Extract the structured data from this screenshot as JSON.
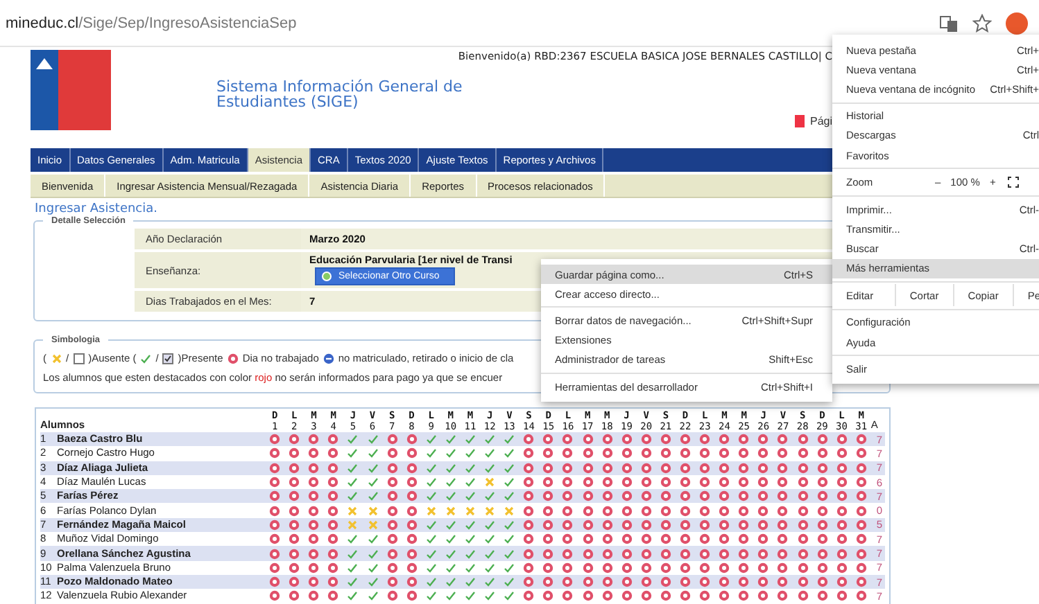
{
  "browser": {
    "url_host": "mineduc.cl",
    "url_path": "/Sige/Sep/IngresoAsistenciaSep"
  },
  "header": {
    "welcome": "Bienvenido(a) RBD:2367  ESCUELA BASICA JOSE BERNALES CASTILLO| C",
    "title_line1": "Sistema Información General de",
    "title_line2": "Estudiantes (SIGE)",
    "print_link": "Pági"
  },
  "tabs": [
    {
      "label": "Inicio",
      "selected": false
    },
    {
      "label": "Datos Generales",
      "selected": false
    },
    {
      "label": "Adm. Matricula",
      "selected": false
    },
    {
      "label": "Asistencia",
      "selected": true
    },
    {
      "label": "CRA",
      "selected": false
    },
    {
      "label": "Textos 2020",
      "selected": false
    },
    {
      "label": "Ajuste Textos",
      "selected": false
    },
    {
      "label": "Reportes y Archivos",
      "selected": false
    }
  ],
  "subtabs": [
    "Bienvenida",
    "Ingresar Asistencia Mensual/Rezagada",
    "Asistencia Diaria",
    "Reportes",
    "Procesos relacionados"
  ],
  "section_title": "Ingresar Asistencia.",
  "detail": {
    "legend": "Detalle Selección",
    "rows": [
      {
        "label": "Año Declaración",
        "value": "Marzo 2020"
      },
      {
        "label": "Enseñanza:",
        "value": "Educación Parvularia [1er nivel de Transi",
        "button": "Seleccionar Otro Curso"
      },
      {
        "label": "Dias Trabajados en el Mes:",
        "value": "7"
      }
    ]
  },
  "legend_box": {
    "legend": "Simbologia",
    "open_paren": "(",
    "slash_1": "/",
    "absent": ")Ausente (",
    "slash_2": "/",
    "present": ")Presente",
    "not_worked": "Dia no trabajado",
    "not_enrolled": "no matriculado, retirado o inicio de cla",
    "note_before": "Los alumnos que esten destacados con color",
    "note_highlight": "rojo",
    "note_after": "no serán informados para pago ya que se encuer"
  },
  "grid": {
    "header": "Alumnos",
    "total_header": "A",
    "days": [
      {
        "letter": "D",
        "number": "1"
      },
      {
        "letter": "L",
        "number": "2"
      },
      {
        "letter": "M",
        "number": "3"
      },
      {
        "letter": "M",
        "number": "4"
      },
      {
        "letter": "J",
        "number": "5"
      },
      {
        "letter": "V",
        "number": "6"
      },
      {
        "letter": "S",
        "number": "7"
      },
      {
        "letter": "D",
        "number": "8"
      },
      {
        "letter": "L",
        "number": "9"
      },
      {
        "letter": "M",
        "number": "10"
      },
      {
        "letter": "M",
        "number": "11"
      },
      {
        "letter": "J",
        "number": "12"
      },
      {
        "letter": "V",
        "number": "13"
      },
      {
        "letter": "S",
        "number": "14"
      },
      {
        "letter": "D",
        "number": "15"
      },
      {
        "letter": "L",
        "number": "16"
      },
      {
        "letter": "M",
        "number": "17"
      },
      {
        "letter": "M",
        "number": "18"
      },
      {
        "letter": "J",
        "number": "19"
      },
      {
        "letter": "V",
        "number": "20"
      },
      {
        "letter": "S",
        "number": "21"
      },
      {
        "letter": "D",
        "number": "22"
      },
      {
        "letter": "L",
        "number": "23"
      },
      {
        "letter": "M",
        "number": "24"
      },
      {
        "letter": "M",
        "number": "25"
      },
      {
        "letter": "J",
        "number": "26"
      },
      {
        "letter": "V",
        "number": "27"
      },
      {
        "letter": "S",
        "number": "28"
      },
      {
        "letter": "D",
        "number": "29"
      },
      {
        "letter": "L",
        "number": "30"
      },
      {
        "letter": "M",
        "number": "31"
      }
    ],
    "rows": [
      {
        "number": "1",
        "name": "Baeza Castro Blu",
        "total": "7",
        "marks": [
          {
            "kind": "o"
          },
          {
            "kind": "o"
          },
          {
            "kind": "o"
          },
          {
            "kind": "o"
          },
          {
            "kind": "p"
          },
          {
            "kind": "p"
          },
          {
            "kind": "o"
          },
          {
            "kind": "o"
          },
          {
            "kind": "p"
          },
          {
            "kind": "p"
          },
          {
            "kind": "p"
          },
          {
            "kind": "p"
          },
          {
            "kind": "p"
          },
          {
            "kind": "o"
          },
          {
            "kind": "o"
          },
          {
            "kind": "o"
          },
          {
            "kind": "o"
          },
          {
            "kind": "o"
          },
          {
            "kind": "o"
          },
          {
            "kind": "o"
          },
          {
            "kind": "o"
          },
          {
            "kind": "o"
          },
          {
            "kind": "o"
          },
          {
            "kind": "o"
          },
          {
            "kind": "o"
          },
          {
            "kind": "o"
          },
          {
            "kind": "o"
          },
          {
            "kind": "o"
          },
          {
            "kind": "o"
          },
          {
            "kind": "o"
          },
          {
            "kind": "o"
          }
        ]
      },
      {
        "number": "2",
        "name": "Cornejo Castro Hugo",
        "total": "7",
        "marks": [
          {
            "kind": "o"
          },
          {
            "kind": "o"
          },
          {
            "kind": "o"
          },
          {
            "kind": "o"
          },
          {
            "kind": "p"
          },
          {
            "kind": "p"
          },
          {
            "kind": "o"
          },
          {
            "kind": "o"
          },
          {
            "kind": "p"
          },
          {
            "kind": "p"
          },
          {
            "kind": "p"
          },
          {
            "kind": "p"
          },
          {
            "kind": "p"
          },
          {
            "kind": "o"
          },
          {
            "kind": "o"
          },
          {
            "kind": "o"
          },
          {
            "kind": "o"
          },
          {
            "kind": "o"
          },
          {
            "kind": "o"
          },
          {
            "kind": "o"
          },
          {
            "kind": "o"
          },
          {
            "kind": "o"
          },
          {
            "kind": "o"
          },
          {
            "kind": "o"
          },
          {
            "kind": "o"
          },
          {
            "kind": "o"
          },
          {
            "kind": "o"
          },
          {
            "kind": "o"
          },
          {
            "kind": "o"
          },
          {
            "kind": "o"
          },
          {
            "kind": "o"
          }
        ]
      },
      {
        "number": "3",
        "name": "Díaz Aliaga Julieta",
        "total": "7",
        "marks": [
          {
            "kind": "o"
          },
          {
            "kind": "o"
          },
          {
            "kind": "o"
          },
          {
            "kind": "o"
          },
          {
            "kind": "p"
          },
          {
            "kind": "p"
          },
          {
            "kind": "o"
          },
          {
            "kind": "o"
          },
          {
            "kind": "p"
          },
          {
            "kind": "p"
          },
          {
            "kind": "p"
          },
          {
            "kind": "p"
          },
          {
            "kind": "p"
          },
          {
            "kind": "o"
          },
          {
            "kind": "o"
          },
          {
            "kind": "o"
          },
          {
            "kind": "o"
          },
          {
            "kind": "o"
          },
          {
            "kind": "o"
          },
          {
            "kind": "o"
          },
          {
            "kind": "o"
          },
          {
            "kind": "o"
          },
          {
            "kind": "o"
          },
          {
            "kind": "o"
          },
          {
            "kind": "o"
          },
          {
            "kind": "o"
          },
          {
            "kind": "o"
          },
          {
            "kind": "o"
          },
          {
            "kind": "o"
          },
          {
            "kind": "o"
          },
          {
            "kind": "o"
          }
        ]
      },
      {
        "number": "4",
        "name": "Díaz Maulén Lucas",
        "total": "6",
        "marks": [
          {
            "kind": "o"
          },
          {
            "kind": "o"
          },
          {
            "kind": "o"
          },
          {
            "kind": "o"
          },
          {
            "kind": "p"
          },
          {
            "kind": "p"
          },
          {
            "kind": "o"
          },
          {
            "kind": "o"
          },
          {
            "kind": "p"
          },
          {
            "kind": "p"
          },
          {
            "kind": "p"
          },
          {
            "kind": "a"
          },
          {
            "kind": "p"
          },
          {
            "kind": "o"
          },
          {
            "kind": "o"
          },
          {
            "kind": "o"
          },
          {
            "kind": "o"
          },
          {
            "kind": "o"
          },
          {
            "kind": "o"
          },
          {
            "kind": "o"
          },
          {
            "kind": "o"
          },
          {
            "kind": "o"
          },
          {
            "kind": "o"
          },
          {
            "kind": "o"
          },
          {
            "kind": "o"
          },
          {
            "kind": "o"
          },
          {
            "kind": "o"
          },
          {
            "kind": "o"
          },
          {
            "kind": "o"
          },
          {
            "kind": "o"
          },
          {
            "kind": "o"
          }
        ]
      },
      {
        "number": "5",
        "name": "Farías Pérez",
        "total": "7",
        "marks": [
          {
            "kind": "o"
          },
          {
            "kind": "o"
          },
          {
            "kind": "o"
          },
          {
            "kind": "o"
          },
          {
            "kind": "p"
          },
          {
            "kind": "p"
          },
          {
            "kind": "o"
          },
          {
            "kind": "o"
          },
          {
            "kind": "p"
          },
          {
            "kind": "p"
          },
          {
            "kind": "p"
          },
          {
            "kind": "p"
          },
          {
            "kind": "p"
          },
          {
            "kind": "o"
          },
          {
            "kind": "o"
          },
          {
            "kind": "o"
          },
          {
            "kind": "o"
          },
          {
            "kind": "o"
          },
          {
            "kind": "o"
          },
          {
            "kind": "o"
          },
          {
            "kind": "o"
          },
          {
            "kind": "o"
          },
          {
            "kind": "o"
          },
          {
            "kind": "o"
          },
          {
            "kind": "o"
          },
          {
            "kind": "o"
          },
          {
            "kind": "o"
          },
          {
            "kind": "o"
          },
          {
            "kind": "o"
          },
          {
            "kind": "o"
          },
          {
            "kind": "o"
          }
        ]
      },
      {
        "number": "6",
        "name": "Farías Polanco Dylan",
        "total": "0",
        "marks": [
          {
            "kind": "o"
          },
          {
            "kind": "o"
          },
          {
            "kind": "o"
          },
          {
            "kind": "o"
          },
          {
            "kind": "a"
          },
          {
            "kind": "a"
          },
          {
            "kind": "o"
          },
          {
            "kind": "o"
          },
          {
            "kind": "a"
          },
          {
            "kind": "a"
          },
          {
            "kind": "a"
          },
          {
            "kind": "a"
          },
          {
            "kind": "a"
          },
          {
            "kind": "o"
          },
          {
            "kind": "o"
          },
          {
            "kind": "o"
          },
          {
            "kind": "o"
          },
          {
            "kind": "o"
          },
          {
            "kind": "o"
          },
          {
            "kind": "o"
          },
          {
            "kind": "o"
          },
          {
            "kind": "o"
          },
          {
            "kind": "o"
          },
          {
            "kind": "o"
          },
          {
            "kind": "o"
          },
          {
            "kind": "o"
          },
          {
            "kind": "o"
          },
          {
            "kind": "o"
          },
          {
            "kind": "o"
          },
          {
            "kind": "o"
          },
          {
            "kind": "o"
          }
        ]
      },
      {
        "number": "7",
        "name": "Fernández Magaña Maicol",
        "total": "5",
        "marks": [
          {
            "kind": "o"
          },
          {
            "kind": "o"
          },
          {
            "kind": "o"
          },
          {
            "kind": "o"
          },
          {
            "kind": "a"
          },
          {
            "kind": "a"
          },
          {
            "kind": "o"
          },
          {
            "kind": "o"
          },
          {
            "kind": "p"
          },
          {
            "kind": "p"
          },
          {
            "kind": "p"
          },
          {
            "kind": "p"
          },
          {
            "kind": "p"
          },
          {
            "kind": "o"
          },
          {
            "kind": "o"
          },
          {
            "kind": "o"
          },
          {
            "kind": "o"
          },
          {
            "kind": "o"
          },
          {
            "kind": "o"
          },
          {
            "kind": "o"
          },
          {
            "kind": "o"
          },
          {
            "kind": "o"
          },
          {
            "kind": "o"
          },
          {
            "kind": "o"
          },
          {
            "kind": "o"
          },
          {
            "kind": "o"
          },
          {
            "kind": "o"
          },
          {
            "kind": "o"
          },
          {
            "kind": "o"
          },
          {
            "kind": "o"
          },
          {
            "kind": "o"
          }
        ]
      },
      {
        "number": "8",
        "name": "Muñoz Vidal Domingo",
        "total": "7",
        "marks": [
          {
            "kind": "o"
          },
          {
            "kind": "o"
          },
          {
            "kind": "o"
          },
          {
            "kind": "o"
          },
          {
            "kind": "p"
          },
          {
            "kind": "p"
          },
          {
            "kind": "o"
          },
          {
            "kind": "o"
          },
          {
            "kind": "p"
          },
          {
            "kind": "p"
          },
          {
            "kind": "p"
          },
          {
            "kind": "p"
          },
          {
            "kind": "p"
          },
          {
            "kind": "o"
          },
          {
            "kind": "o"
          },
          {
            "kind": "o"
          },
          {
            "kind": "o"
          },
          {
            "kind": "o"
          },
          {
            "kind": "o"
          },
          {
            "kind": "o"
          },
          {
            "kind": "o"
          },
          {
            "kind": "o"
          },
          {
            "kind": "o"
          },
          {
            "kind": "o"
          },
          {
            "kind": "o"
          },
          {
            "kind": "o"
          },
          {
            "kind": "o"
          },
          {
            "kind": "o"
          },
          {
            "kind": "o"
          },
          {
            "kind": "o"
          },
          {
            "kind": "o"
          }
        ]
      },
      {
        "number": "9",
        "name": "Orellana Sánchez Agustina",
        "total": "7",
        "marks": [
          {
            "kind": "o"
          },
          {
            "kind": "o"
          },
          {
            "kind": "o"
          },
          {
            "kind": "o"
          },
          {
            "kind": "p"
          },
          {
            "kind": "p"
          },
          {
            "kind": "o"
          },
          {
            "kind": "o"
          },
          {
            "kind": "p"
          },
          {
            "kind": "p"
          },
          {
            "kind": "p"
          },
          {
            "kind": "p"
          },
          {
            "kind": "p"
          },
          {
            "kind": "o"
          },
          {
            "kind": "o"
          },
          {
            "kind": "o"
          },
          {
            "kind": "o"
          },
          {
            "kind": "o"
          },
          {
            "kind": "o"
          },
          {
            "kind": "o"
          },
          {
            "kind": "o"
          },
          {
            "kind": "o"
          },
          {
            "kind": "o"
          },
          {
            "kind": "o"
          },
          {
            "kind": "o"
          },
          {
            "kind": "o"
          },
          {
            "kind": "o"
          },
          {
            "kind": "o"
          },
          {
            "kind": "o"
          },
          {
            "kind": "o"
          },
          {
            "kind": "o"
          }
        ]
      },
      {
        "number": "10",
        "name": "Palma Valenzuela Bruno",
        "total": "7",
        "marks": [
          {
            "kind": "o"
          },
          {
            "kind": "o"
          },
          {
            "kind": "o"
          },
          {
            "kind": "o"
          },
          {
            "kind": "p"
          },
          {
            "kind": "p"
          },
          {
            "kind": "o"
          },
          {
            "kind": "o"
          },
          {
            "kind": "p"
          },
          {
            "kind": "p"
          },
          {
            "kind": "p"
          },
          {
            "kind": "p"
          },
          {
            "kind": "p"
          },
          {
            "kind": "o"
          },
          {
            "kind": "o"
          },
          {
            "kind": "o"
          },
          {
            "kind": "o"
          },
          {
            "kind": "o"
          },
          {
            "kind": "o"
          },
          {
            "kind": "o"
          },
          {
            "kind": "o"
          },
          {
            "kind": "o"
          },
          {
            "kind": "o"
          },
          {
            "kind": "o"
          },
          {
            "kind": "o"
          },
          {
            "kind": "o"
          },
          {
            "kind": "o"
          },
          {
            "kind": "o"
          },
          {
            "kind": "o"
          },
          {
            "kind": "o"
          },
          {
            "kind": "o"
          }
        ]
      },
      {
        "number": "11",
        "name": "Pozo Maldonado Mateo",
        "total": "7",
        "marks": [
          {
            "kind": "o"
          },
          {
            "kind": "o"
          },
          {
            "kind": "o"
          },
          {
            "kind": "o"
          },
          {
            "kind": "p"
          },
          {
            "kind": "p"
          },
          {
            "kind": "o"
          },
          {
            "kind": "o"
          },
          {
            "kind": "p"
          },
          {
            "kind": "p"
          },
          {
            "kind": "p"
          },
          {
            "kind": "p"
          },
          {
            "kind": "p"
          },
          {
            "kind": "o"
          },
          {
            "kind": "o"
          },
          {
            "kind": "o"
          },
          {
            "kind": "o"
          },
          {
            "kind": "o"
          },
          {
            "kind": "o"
          },
          {
            "kind": "o"
          },
          {
            "kind": "o"
          },
          {
            "kind": "o"
          },
          {
            "kind": "o"
          },
          {
            "kind": "o"
          },
          {
            "kind": "o"
          },
          {
            "kind": "o"
          },
          {
            "kind": "o"
          },
          {
            "kind": "o"
          },
          {
            "kind": "o"
          },
          {
            "kind": "o"
          },
          {
            "kind": "o"
          }
        ]
      },
      {
        "number": "12",
        "name": "Valenzuela Rubio Alexander",
        "total": "7",
        "marks": [
          {
            "kind": "o"
          },
          {
            "kind": "o"
          },
          {
            "kind": "o"
          },
          {
            "kind": "o"
          },
          {
            "kind": "p"
          },
          {
            "kind": "p"
          },
          {
            "kind": "o"
          },
          {
            "kind": "o"
          },
          {
            "kind": "p"
          },
          {
            "kind": "p"
          },
          {
            "kind": "p"
          },
          {
            "kind": "p"
          },
          {
            "kind": "p"
          },
          {
            "kind": "o"
          },
          {
            "kind": "o"
          },
          {
            "kind": "o"
          },
          {
            "kind": "o"
          },
          {
            "kind": "o"
          },
          {
            "kind": "o"
          },
          {
            "kind": "o"
          },
          {
            "kind": "o"
          },
          {
            "kind": "o"
          },
          {
            "kind": "o"
          },
          {
            "kind": "o"
          },
          {
            "kind": "o"
          },
          {
            "kind": "o"
          },
          {
            "kind": "o"
          },
          {
            "kind": "o"
          },
          {
            "kind": "o"
          },
          {
            "kind": "o"
          },
          {
            "kind": "o"
          }
        ]
      }
    ]
  },
  "browser_menu": {
    "groups": [
      [
        {
          "kind": "item",
          "label": "Nueva pestaña",
          "shortcut": "Ctrl+",
          "highlighted": false
        },
        {
          "kind": "item",
          "label": "Nueva ventana",
          "shortcut": "Ctrl+",
          "highlighted": false
        },
        {
          "kind": "item",
          "label": "Nueva ventana de incógnito",
          "shortcut": "Ctrl+Shift+",
          "highlighted": false
        }
      ],
      [
        {
          "kind": "item",
          "label": "Historial",
          "highlighted": false
        },
        {
          "kind": "item",
          "label": "Descargas",
          "shortcut": "Ctrl",
          "highlighted": false
        },
        {
          "kind": "item",
          "label": "Favoritos",
          "highlighted": false
        }
      ],
      [
        {
          "kind": "zoom",
          "label": "Zoom",
          "minus": "–",
          "value": "100 %",
          "plus": "+"
        }
      ],
      [
        {
          "kind": "item",
          "label": "Imprimir...",
          "shortcut": "Ctrl-",
          "highlighted": false
        },
        {
          "kind": "item",
          "label": "Transmitir...",
          "highlighted": false
        },
        {
          "kind": "item",
          "label": "Buscar",
          "shortcut": "Ctrl-",
          "highlighted": false
        },
        {
          "kind": "item",
          "label": "Más herramientas",
          "highlighted": true
        }
      ],
      [
        {
          "kind": "edit",
          "label": "Editar",
          "buttons": [
            "Cortar",
            "Copiar",
            "Pe"
          ]
        }
      ],
      [
        {
          "kind": "item",
          "label": "Configuración",
          "highlighted": false
        },
        {
          "kind": "item",
          "label": "Ayuda",
          "highlighted": false
        }
      ],
      [
        {
          "kind": "item",
          "label": "Salir",
          "highlighted": false
        }
      ]
    ]
  },
  "submenu": {
    "groups": [
      [
        {
          "label": "Guardar página como...",
          "shortcut": "Ctrl+S",
          "highlighted": true
        },
        {
          "label": "Crear acceso directo...",
          "highlighted": false
        }
      ],
      [
        {
          "label": "Borrar datos de navegación...",
          "shortcut": "Ctrl+Shift+Supr",
          "highlighted": false
        },
        {
          "label": "Extensiones",
          "highlighted": false
        },
        {
          "label": "Administrador de tareas",
          "shortcut": "Shift+Esc",
          "highlighted": false
        }
      ],
      [
        {
          "label": "Herramientas del desarrollador",
          "shortcut": "Ctrl+Shift+I",
          "highlighted": false
        }
      ]
    ]
  }
}
